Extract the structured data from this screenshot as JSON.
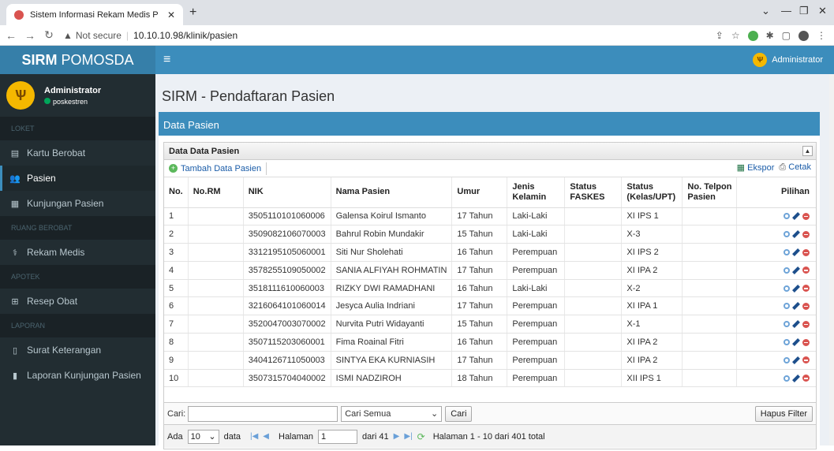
{
  "browser": {
    "tab_title": "Sistem Informasi Rekam Medis P",
    "new_tab": "+",
    "not_secure": "Not secure",
    "url": "10.10.10.98/klinik/pasien"
  },
  "brand": {
    "bold": "SIRM",
    "rest": "POMOSDA"
  },
  "user": {
    "name": "Administrator",
    "status": "poskestren"
  },
  "sidebar": {
    "sections": [
      {
        "header": "LOKET",
        "items": [
          {
            "label": "Kartu Berobat",
            "icon": "card-icon"
          },
          {
            "label": "Pasien",
            "icon": "users-icon",
            "active": true
          },
          {
            "label": "Kunjungan Pasien",
            "icon": "hospital-icon"
          }
        ]
      },
      {
        "header": "RUANG BEROBAT",
        "items": [
          {
            "label": "Rekam Medis",
            "icon": "stethoscope-icon"
          }
        ]
      },
      {
        "header": "APOTEK",
        "items": [
          {
            "label": "Resep Obat",
            "icon": "medkit-icon"
          }
        ]
      },
      {
        "header": "LAPORAN",
        "items": [
          {
            "label": "Surat Keterangan",
            "icon": "file-icon"
          },
          {
            "label": "Laporan Kunjungan Pasien",
            "icon": "file-filled-icon"
          }
        ]
      }
    ]
  },
  "topnav": {
    "user": "Administrator"
  },
  "page": {
    "title": "SIRM - Pendaftaran Pasien",
    "box_title": "Data Pasien"
  },
  "grid": {
    "title": "Data Data Pasien",
    "add_label": "Tambah Data Pasien",
    "export_label": "Ekspor",
    "print_label": "Cetak",
    "columns": [
      "No.",
      "No.RM",
      "NIK",
      "Nama Pasien",
      "Umur",
      "Jenis Kelamin",
      "Status FASKES",
      "Status (Kelas/UPT)",
      "No. Telpon Pasien",
      "Pilihan"
    ],
    "rows": [
      {
        "no": "1",
        "rm": "",
        "nik": "3505110101060006",
        "nama": "Galensa Koirul Ismanto",
        "umur": "17 Tahun",
        "jk": "Laki-Laki",
        "faskes": "",
        "kelas": "XI IPS 1",
        "telp": ""
      },
      {
        "no": "2",
        "rm": "",
        "nik": "3509082106070003",
        "nama": "Bahrul Robin Mundakir",
        "umur": "15 Tahun",
        "jk": "Laki-Laki",
        "faskes": "",
        "kelas": "X-3",
        "telp": ""
      },
      {
        "no": "3",
        "rm": "",
        "nik": "3312195105060001",
        "nama": "Siti Nur Sholehati",
        "umur": "16 Tahun",
        "jk": "Perempuan",
        "faskes": "",
        "kelas": "XI IPS 2",
        "telp": ""
      },
      {
        "no": "4",
        "rm": "",
        "nik": "3578255109050002",
        "nama": "SANIA ALFIYAH ROHMATIN",
        "umur": "17 Tahun",
        "jk": "Perempuan",
        "faskes": "",
        "kelas": "XI IPA 2",
        "telp": ""
      },
      {
        "no": "5",
        "rm": "",
        "nik": "3518111610060003",
        "nama": "RIZKY DWI RAMADHANI",
        "umur": "16 Tahun",
        "jk": "Laki-Laki",
        "faskes": "",
        "kelas": "X-2",
        "telp": ""
      },
      {
        "no": "6",
        "rm": "",
        "nik": "3216064101060014",
        "nama": "Jesyca Aulia Indriani",
        "umur": "17 Tahun",
        "jk": "Perempuan",
        "faskes": "",
        "kelas": "XI IPA 1",
        "telp": ""
      },
      {
        "no": "7",
        "rm": "",
        "nik": "3520047003070002",
        "nama": "Nurvita Putri Widayanti",
        "umur": "15 Tahun",
        "jk": "Perempuan",
        "faskes": "",
        "kelas": "X-1",
        "telp": ""
      },
      {
        "no": "8",
        "rm": "",
        "nik": "3507115203060001",
        "nama": "Fima Roainal Fitri",
        "umur": "16 Tahun",
        "jk": "Perempuan",
        "faskes": "",
        "kelas": "XI IPA 2",
        "telp": ""
      },
      {
        "no": "9",
        "rm": "",
        "nik": "3404126711050003",
        "nama": "SINTYA EKA KURNIASIH",
        "umur": "17 Tahun",
        "jk": "Perempuan",
        "faskes": "",
        "kelas": "XI IPA 2",
        "telp": ""
      },
      {
        "no": "10",
        "rm": "",
        "nik": "3507315704040002",
        "nama": "ISMI NADZIROH",
        "umur": "18 Tahun",
        "jk": "Perempuan",
        "faskes": "",
        "kelas": "XII IPS 1",
        "telp": ""
      }
    ]
  },
  "search": {
    "label": "Cari:",
    "value": "",
    "select": "Cari Semua",
    "button": "Cari",
    "clear": "Hapus Filter"
  },
  "pager": {
    "ada": "Ada",
    "per_page": "10",
    "data": "data",
    "halaman": "Halaman",
    "page": "1",
    "of": "dari 41",
    "summary": "Halaman 1 - 10 dari 401 total"
  }
}
